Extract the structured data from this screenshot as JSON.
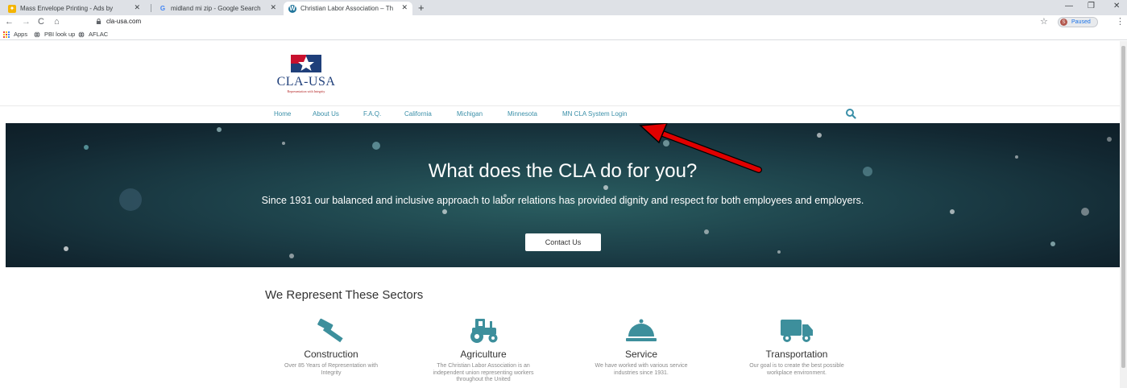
{
  "browser": {
    "tabs": [
      {
        "title": "Mass Envelope Printing - Ads by",
        "active": false
      },
      {
        "title": "midland mi zip - Google Search",
        "active": false
      },
      {
        "title": "Christian Labor Association – Th",
        "active": true
      }
    ],
    "url": "cla-usa.com",
    "profile_status": "Paused",
    "profile_initial": "S",
    "bookmarks": [
      "Apps",
      "PBI look up",
      "AFLAC"
    ]
  },
  "site": {
    "logo_text": "CLA-USA",
    "logo_tagline": "Representation with Integrity",
    "nav": [
      "Home",
      "About Us",
      "F.A.Q.",
      "California",
      "Michigan",
      "Minnesota",
      "MN CLA System Login"
    ],
    "hero": {
      "title": "What does the CLA do for you?",
      "subtitle": "Since 1931 our balanced and inclusive approach to labor relations has provided dignity and respect for both employees and employers.",
      "cta": "Contact Us"
    },
    "sectors_heading": "We Represent These Sectors",
    "sectors": [
      {
        "title": "Construction",
        "description": "Over 85 Years of Representation with Integrity",
        "icon": "hammer-icon"
      },
      {
        "title": "Agriculture",
        "description": "The Christian Labor Association is an independent union representing workers throughout the United",
        "icon": "tractor-icon"
      },
      {
        "title": "Service",
        "description": "We have worked with various service industries since 1931.",
        "icon": "service-bell-icon"
      },
      {
        "title": "Transportation",
        "description": "Our goal is to create the best possible workplace environment.",
        "icon": "truck-icon"
      }
    ]
  },
  "colors": {
    "accent": "#3a8fa8",
    "icon_teal": "#3d8f9c",
    "hero_bg": "#1c3f48",
    "annotation_arrow": "#e00000"
  }
}
